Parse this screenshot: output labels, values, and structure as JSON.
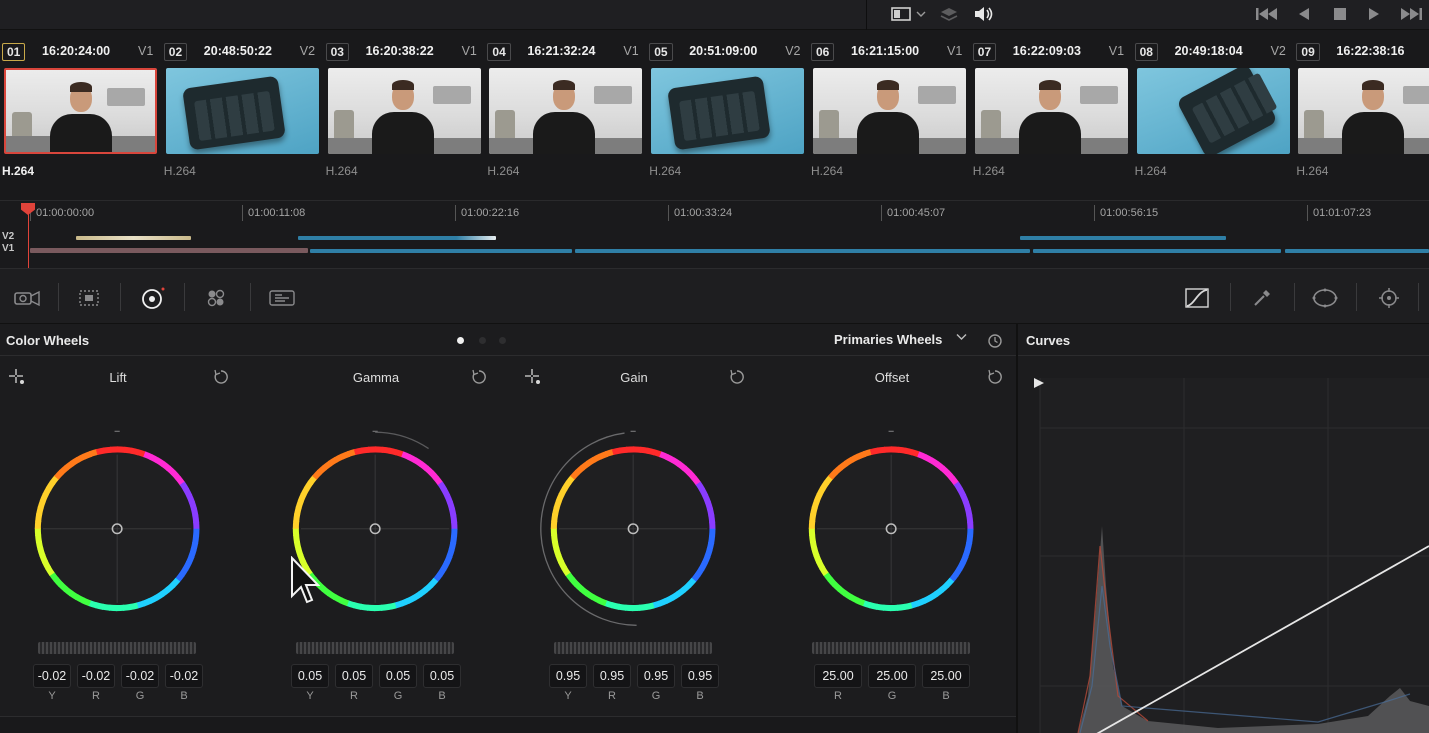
{
  "clips": [
    {
      "number": "01",
      "timecode": "16:20:24:00",
      "track": "V1",
      "codec": "H.264",
      "thumb": "presenter",
      "active": true
    },
    {
      "number": "02",
      "timecode": "20:48:50:22",
      "track": "V2",
      "codec": "H.264",
      "thumb": "deck"
    },
    {
      "number": "03",
      "timecode": "16:20:38:22",
      "track": "V1",
      "codec": "H.264",
      "thumb": "presenter"
    },
    {
      "number": "04",
      "timecode": "16:21:32:24",
      "track": "V1",
      "codec": "H.264",
      "thumb": "presenter"
    },
    {
      "number": "05",
      "timecode": "20:51:09:00",
      "track": "V2",
      "codec": "H.264",
      "thumb": "deck"
    },
    {
      "number": "06",
      "timecode": "16:21:15:00",
      "track": "V1",
      "codec": "H.264",
      "thumb": "presenter"
    },
    {
      "number": "07",
      "timecode": "16:22:09:03",
      "track": "V1",
      "codec": "H.264",
      "thumb": "presenter"
    },
    {
      "number": "08",
      "timecode": "20:49:18:04",
      "track": "V2",
      "codec": "H.264",
      "thumb": "deck-alt"
    },
    {
      "number": "09",
      "timecode": "16:22:38:16",
      "track": "",
      "codec": "H.264",
      "thumb": "presenter"
    }
  ],
  "timeline": {
    "ticks": [
      "01:00:00:00",
      "01:00:11:08",
      "01:00:22:16",
      "01:00:33:24",
      "01:00:45:07",
      "01:00:56:15",
      "01:01:07:23"
    ],
    "tracks": [
      "V2",
      "V1"
    ]
  },
  "color_wheels": {
    "title": "Color Wheels",
    "mode": "Primaries Wheels",
    "wheels": [
      {
        "label": "Lift",
        "values": [
          "-0.02",
          "-0.02",
          "-0.02",
          "-0.02"
        ],
        "channels": [
          "Y",
          "R",
          "G",
          "B"
        ]
      },
      {
        "label": "Gamma",
        "values": [
          "0.05",
          "0.05",
          "0.05",
          "0.05"
        ],
        "channels": [
          "Y",
          "R",
          "G",
          "B"
        ]
      },
      {
        "label": "Gain",
        "values": [
          "0.95",
          "0.95",
          "0.95",
          "0.95"
        ],
        "channels": [
          "Y",
          "R",
          "G",
          "B"
        ]
      },
      {
        "label": "Offset",
        "values": [
          "25.00",
          "25.00",
          "25.00"
        ],
        "channels": [
          "R",
          "G",
          "B"
        ]
      }
    ]
  },
  "curves": {
    "title": "Curves"
  },
  "colors": {
    "accent_red": "#d8463c",
    "clip_track_blue": "#2f7fa6",
    "clip_track_tan": "#c9b98a"
  }
}
